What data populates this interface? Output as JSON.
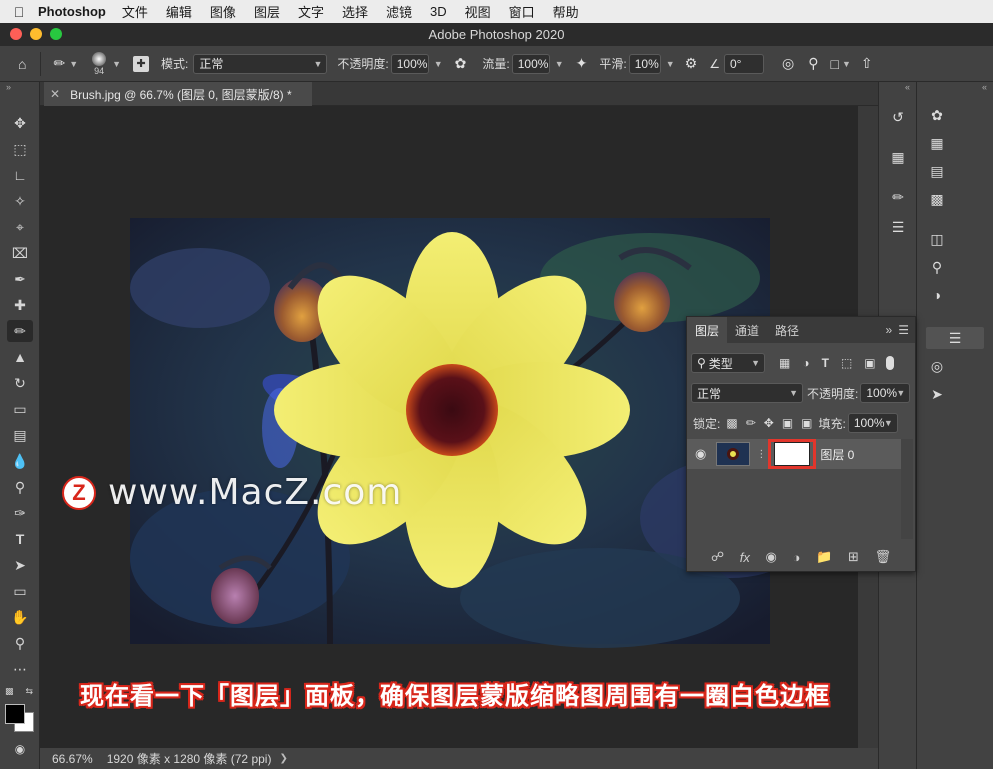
{
  "menubar": {
    "app_name": "Photoshop",
    "items": [
      "文件",
      "编辑",
      "图像",
      "图层",
      "文字",
      "选择",
      "滤镜",
      "3D",
      "视图",
      "窗口",
      "帮助"
    ]
  },
  "window": {
    "title": "Adobe Photoshop 2020"
  },
  "options": {
    "brush_size": "94",
    "mode_label": "模式:",
    "mode_value": "正常",
    "opacity_label": "不透明度:",
    "opacity_value": "100%",
    "flow_label": "流量:",
    "flow_value": "100%",
    "smooth_label": "平滑:",
    "smooth_value": "10%",
    "angle_value": "0°"
  },
  "document": {
    "tab_label": "Brush.jpg @ 66.7% (图层 0, 图层蒙版/8) *",
    "zoom": "66.67%",
    "info": "1920 像素 x 1280 像素 (72 ppi)"
  },
  "layers_panel": {
    "tabs": [
      "图层",
      "通道",
      "路径"
    ],
    "filter_value": "类型",
    "blend_value": "正常",
    "opacity_label": "不透明度:",
    "opacity_value": "100%",
    "lock_label": "锁定:",
    "fill_label": "填充:",
    "fill_value": "100%",
    "layer_name": "图层 0"
  },
  "watermark": {
    "letter": "Z",
    "text": "www.MacZ.com"
  },
  "caption": "现在看一下「图层」面板，确保图层蒙版缩略图周围有一圈白色边框",
  "colors": {
    "highlight_box": "#e2362c",
    "caption_outline": "#d8261b"
  }
}
